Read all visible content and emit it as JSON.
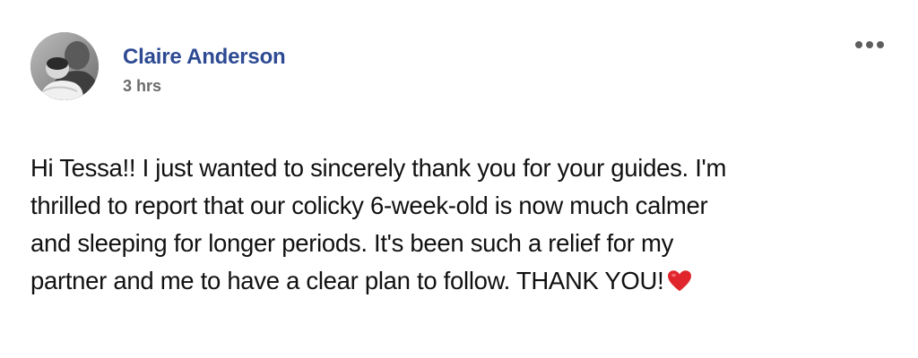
{
  "post": {
    "author": "Claire Anderson",
    "timestamp": "3 hrs",
    "more_icon": "more-horizontal-icon",
    "avatar_icon": "profile-photo",
    "body_lines": [
      "Hi Tessa!! I just wanted to sincerely thank you for your guides. I'm",
      "thrilled to report that our colicky 6-week-old is now much calmer",
      "and sleeping for longer periods. It's been such a relief for my",
      "partner and me to have a clear plan to follow. THANK YOU!"
    ],
    "emoji": "red-heart-icon",
    "colors": {
      "author": "#2d4a93",
      "timestamp": "#6b6b6b",
      "text": "#111111",
      "heart": "#e0262c"
    }
  }
}
